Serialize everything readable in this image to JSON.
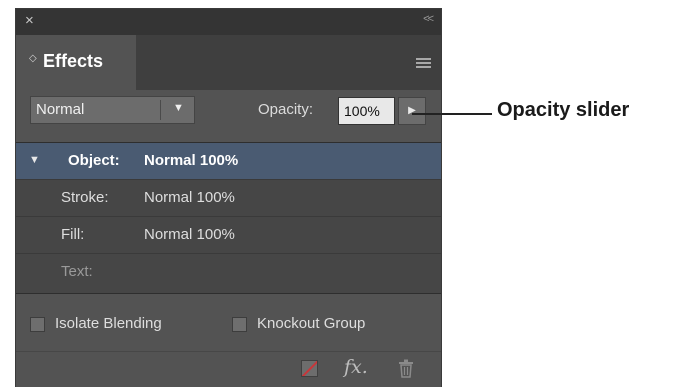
{
  "panel": {
    "close_glyph": "×",
    "collapse_glyph": "<<",
    "tab_arrows_glyph": "◇",
    "tab_label": "Effects",
    "blend_mode": "Normal",
    "opacity_label": "Opacity:",
    "opacity_value": "100%",
    "rows": [
      {
        "label": "Object:",
        "value": "Normal 100%"
      },
      {
        "label": "Stroke:",
        "value": "Normal 100%"
      },
      {
        "label": "Fill:",
        "value": "Normal 100%"
      },
      {
        "label": "Text:",
        "value": ""
      }
    ],
    "isolate_blending_label": "Isolate Blending",
    "knockout_group_label": "Knockout Group",
    "fx_glyph": "fx."
  },
  "annotation": {
    "label": "Opacity slider"
  },
  "icons": {
    "close": "close-icon",
    "collapse": "double-chevron-left-icon",
    "panel_menu": "hamburger-menu-icon",
    "dropdown": "triangle-down-icon",
    "slider": "triangle-right-icon",
    "expand": "disclosure-triangle-icon",
    "clear_effects": "clear-effects-icon",
    "fx": "fx-icon",
    "trash": "trash-icon"
  },
  "colors": {
    "panel_bg": "#535353",
    "selected_row": "#4a5b72",
    "opacity_field_bg": "#e8e8e8"
  },
  "state": {
    "isolate_blending_checked": false,
    "knockout_group_checked": false,
    "object_row_selected": true
  }
}
